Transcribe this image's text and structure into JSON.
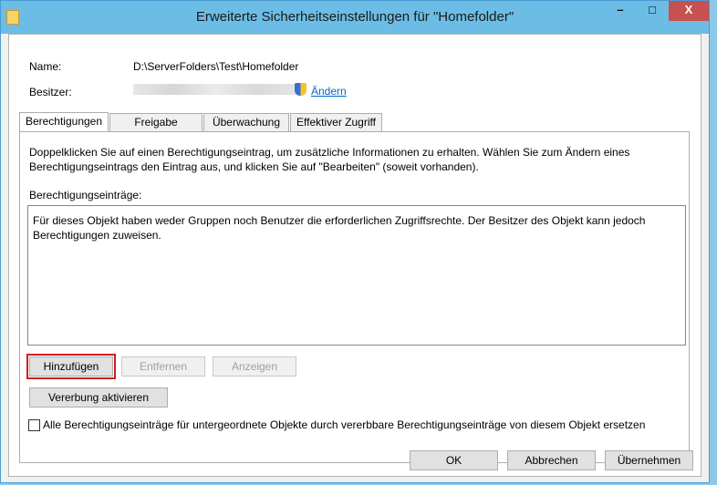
{
  "window": {
    "title": "Erweiterte Sicherheitseinstellungen für \"Homefolder\""
  },
  "titlebar": {
    "minimize": "–",
    "maximize": "□",
    "close": "X"
  },
  "info": {
    "name_label": "Name:",
    "name_value": "D:\\ServerFolders\\Test\\Homefolder",
    "owner_label": "Besitzer:",
    "change_link": "Ändern"
  },
  "tabs": [
    {
      "label": "Berechtigungen"
    },
    {
      "label": "Freigabe"
    },
    {
      "label": "Überwachung"
    },
    {
      "label": "Effektiver Zugriff"
    }
  ],
  "panel": {
    "description": "Doppelklicken Sie auf einen Berechtigungseintrag, um zusätzliche Informationen zu erhalten. Wählen Sie zum Ändern eines Berechtigungseintrags den Eintrag aus, und klicken Sie auf \"Bearbeiten\" (soweit vorhanden).",
    "entries_label": "Berechtigungseinträge:",
    "entries_message": "Für dieses Objekt haben weder Gruppen noch Benutzer die erforderlichen Zugriffsrechte. Der Besitzer des Objekt kann jedoch Berechtigungen zuweisen.",
    "add_button": "Hinzufügen",
    "remove_button": "Entfernen",
    "view_button": "Anzeigen",
    "inheritance_button": "Vererbung aktivieren",
    "replace_checkbox_label": "Alle Berechtigungseinträge für untergeordnete Objekte durch vererbbare Berechtigungseinträge von diesem Objekt ersetzen"
  },
  "footer": {
    "ok": "OK",
    "cancel": "Abbrechen",
    "apply": "Übernehmen"
  },
  "colors": {
    "highlight": "#d21e1e",
    "link": "#0066cc",
    "titlebar": "#6cbde6"
  }
}
